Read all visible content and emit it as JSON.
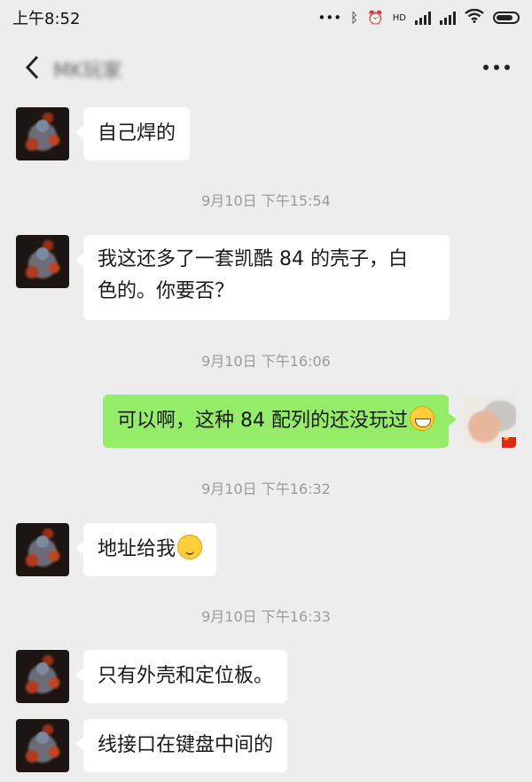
{
  "status": {
    "time": "上午8:52",
    "hd": "HD"
  },
  "header": {
    "title": "MK玩家"
  },
  "messages": [
    {
      "type": "text",
      "from": "other",
      "text": "自己焊的"
    },
    {
      "type": "time",
      "text": "9月10日 下午15:54"
    },
    {
      "type": "text",
      "from": "other",
      "lines": [
        "我这还多了一套凯酷 84 的壳子，白",
        "色的。你要否？"
      ]
    },
    {
      "type": "time",
      "text": "9月10日 下午16:06"
    },
    {
      "type": "text",
      "from": "me",
      "text": "可以啊，这种 84 配列的还没玩过",
      "emoji": "grin-emoji"
    },
    {
      "type": "time",
      "text": "9月10日 下午16:32"
    },
    {
      "type": "text",
      "from": "other",
      "text": "地址给我",
      "emoji": "blush-emoji"
    },
    {
      "type": "time",
      "text": "9月10日 下午16:33"
    },
    {
      "type": "text",
      "from": "other",
      "text": "只有外壳和定位板。"
    },
    {
      "type": "text",
      "from": "other",
      "text": "线接口在键盘中间的"
    }
  ]
}
